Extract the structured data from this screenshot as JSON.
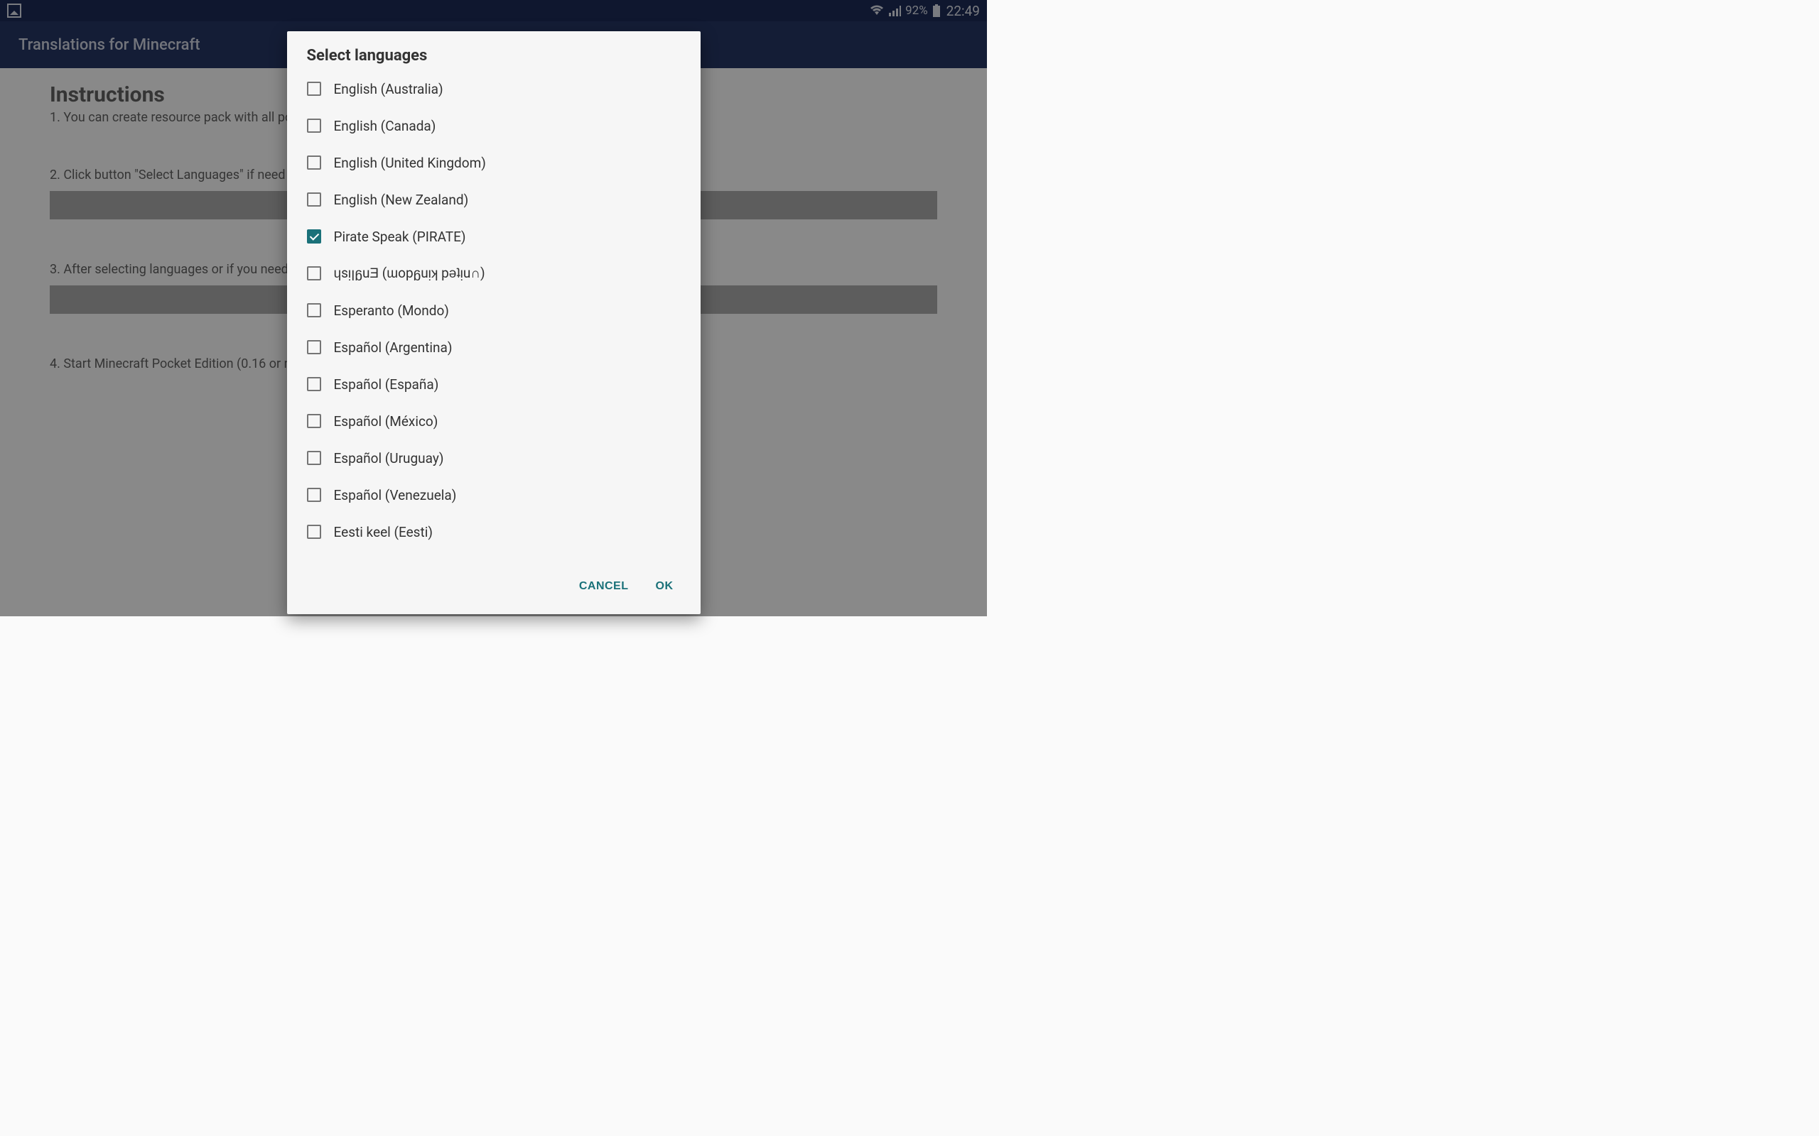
{
  "status_bar": {
    "battery_pct": "92%",
    "time": "22:49"
  },
  "app_bar": {
    "title": "Translations for Minecraft"
  },
  "main": {
    "heading": "Instructions",
    "step1": "1. You can create resource pack with all pos",
    "step2": "2. Click button \"Select Languages\" if need to",
    "step3": "3. After selecting languages or if you need \"",
    "step4": "4. Start Minecraft Pocket Edition (0.16 or ne                                                                                                                                                    t and you will see new languages in language settings menu."
  },
  "dialog": {
    "title": "Select languages",
    "items": [
      {
        "label": "English (Australia)",
        "checked": false
      },
      {
        "label": "English (Canada)",
        "checked": false
      },
      {
        "label": "English (United Kingdom)",
        "checked": false
      },
      {
        "label": "English (New Zealand)",
        "checked": false
      },
      {
        "label": "Pirate Speak (PIRATE)",
        "checked": true
      },
      {
        "label": "ɥsᴉꞁᵷuƎ (ɯopᵷuᴉʞ pǝʇᴉu∩)",
        "checked": false
      },
      {
        "label": "Esperanto (Mondo)",
        "checked": false
      },
      {
        "label": "Español (Argentina)",
        "checked": false
      },
      {
        "label": "Español (España)",
        "checked": false
      },
      {
        "label": "Español (México)",
        "checked": false
      },
      {
        "label": "Español (Uruguay)",
        "checked": false
      },
      {
        "label": "Español (Venezuela)",
        "checked": false
      },
      {
        "label": "Eesti keel (Eesti)",
        "checked": false
      }
    ],
    "cancel": "CANCEL",
    "ok": "OK"
  }
}
